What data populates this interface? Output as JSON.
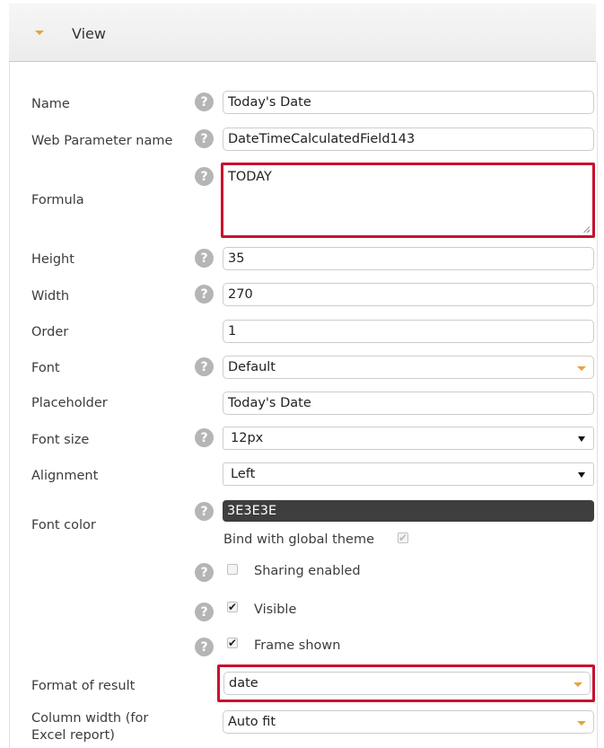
{
  "section": {
    "title": "View"
  },
  "rows": {
    "name": {
      "label": "Name",
      "value": "Today's Date"
    },
    "web_param": {
      "label": "Web Parameter name",
      "value": "DateTimeCalculatedField143"
    },
    "formula": {
      "label": "Formula",
      "value": "TODAY"
    },
    "height": {
      "label": "Height",
      "value": "35"
    },
    "width": {
      "label": "Width",
      "value": "270"
    },
    "order": {
      "label": "Order",
      "value": "1"
    },
    "font": {
      "label": "Font",
      "value": "Default"
    },
    "placeholder": {
      "label": "Placeholder",
      "value": "Today's Date"
    },
    "font_size": {
      "label": "Font size",
      "value": "12px"
    },
    "alignment": {
      "label": "Alignment",
      "value": "Left"
    },
    "font_color": {
      "label": "Font color",
      "value": "3E3E3E",
      "swatch": "#3e3e3e"
    },
    "bind_theme": {
      "label": "Bind with global theme"
    },
    "sharing": {
      "label": "Sharing enabled"
    },
    "visible": {
      "label": "Visible"
    },
    "frame": {
      "label": "Frame shown"
    },
    "format_result": {
      "label": "Format of result",
      "value": "date"
    },
    "col_width": {
      "label_line1": "Column width (for",
      "label_line2": "Excel report)",
      "value": "Auto fit"
    }
  },
  "colors": {
    "highlight": "#c8102e",
    "accent": "#e8a33a",
    "help_icon": "#b5b5b5"
  },
  "icons": {
    "help": "?",
    "check": "✔"
  }
}
